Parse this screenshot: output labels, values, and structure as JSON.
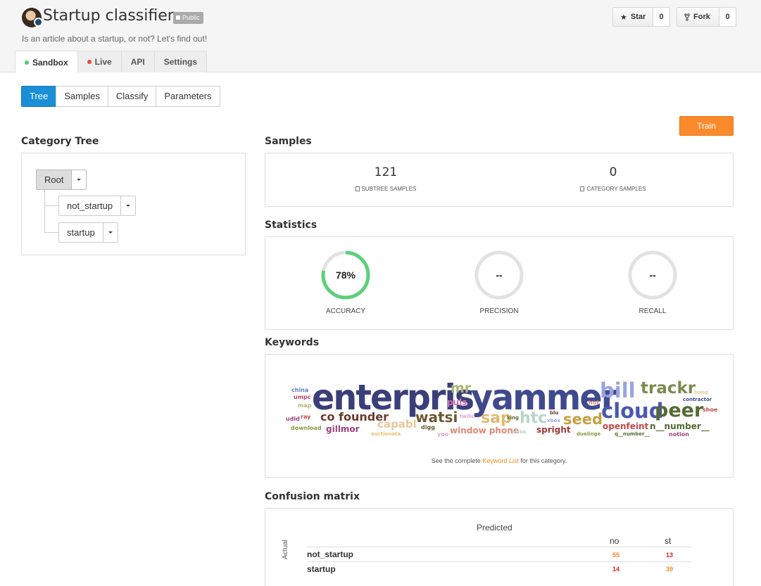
{
  "header": {
    "title": "Startup classifier",
    "visibility": "Public",
    "description": "Is an article about a startup, or not? Let's find out!",
    "star": {
      "label": "Star",
      "count": "0"
    },
    "fork": {
      "label": "Fork",
      "count": "0"
    },
    "tabs": [
      {
        "label": "Sandbox",
        "dot": "#4ccf6a"
      },
      {
        "label": "Live",
        "dot": "#e84a3c"
      },
      {
        "label": "API"
      },
      {
        "label": "Settings"
      }
    ]
  },
  "subnav": [
    "Tree",
    "Samples",
    "Classify",
    "Parameters"
  ],
  "train_label": "Train",
  "category_tree": {
    "title": "Category Tree",
    "root": "Root",
    "children": [
      "not_startup",
      "startup"
    ]
  },
  "samples": {
    "title": "Samples",
    "subtree_count": "121",
    "subtree_label": "SUBTREE SAMPLES",
    "category_count": "0",
    "category_label": "CATEGORY SAMPLES"
  },
  "statistics": {
    "title": "Statistics",
    "accuracy": {
      "value": "78%",
      "fraction": 0.78,
      "label": "ACCURACY"
    },
    "precision": {
      "value": "--",
      "label": "PRECISION"
    },
    "recall": {
      "value": "--",
      "label": "RECALL"
    },
    "gauge_color": "#5cd07a",
    "track_color": "#e2e2e2"
  },
  "keywords": {
    "title": "Keywords",
    "words": [
      {
        "text": "enterpris",
        "color": "#3a3f7a"
      },
      {
        "text": "yammer",
        "color": "#3f4a8e"
      },
      {
        "text": "bill",
        "color": "#9aa3e0"
      },
      {
        "text": "trackr",
        "color": "#7a8a4e"
      },
      {
        "text": "cloud",
        "color": "#4a58b0"
      },
      {
        "text": "peer",
        "color": "#556a34"
      },
      {
        "text": "mr",
        "color": "#a8b870"
      },
      {
        "text": "co founder",
        "color": "#6a3a2a"
      },
      {
        "text": "watsi",
        "color": "#6b5a30"
      },
      {
        "text": "sap",
        "color": "#e0b870"
      },
      {
        "text": "htc",
        "color": "#b8d4c8"
      },
      {
        "text": "seed",
        "color": "#c8a040"
      },
      {
        "text": "capabl",
        "color": "#e8c898"
      },
      {
        "text": "puls",
        "color": "#d070b0"
      },
      {
        "text": "gillmor",
        "color": "#9a4080"
      },
      {
        "text": "window phone",
        "color": "#e08878"
      },
      {
        "text": "spright",
        "color": "#a03838"
      },
      {
        "text": "openfeint",
        "color": "#c04848"
      },
      {
        "text": "n__number__",
        "color": "#556a34"
      },
      {
        "text": "china",
        "color": "#6a78c0"
      },
      {
        "text": "umpc",
        "color": "#c04060"
      },
      {
        "text": "map",
        "color": "#b8b078"
      },
      {
        "text": "ray",
        "color": "#c04848"
      },
      {
        "text": "udid",
        "color": "#9a4080"
      },
      {
        "text": "download",
        "color": "#8a9a40"
      },
      {
        "text": "twilio",
        "color": "#e8a0c8"
      },
      {
        "text": "king",
        "color": "#556a34"
      },
      {
        "text": "digg",
        "color": "#6b5a30"
      },
      {
        "text": "yoo",
        "color": "#e8a0c8"
      },
      {
        "text": "auctionata",
        "color": "#e8c070"
      },
      {
        "text": "ariba",
        "color": "#b8d4c8"
      },
      {
        "text": "blu",
        "color": "#6a3a2a"
      },
      {
        "text": "xbox",
        "color": "#9aa3e0"
      },
      {
        "text": "hot",
        "color": "#e08878"
      },
      {
        "text": "duelinge",
        "color": "#8a9a40"
      },
      {
        "text": "q__number__",
        "color": "#556a34"
      },
      {
        "text": "bond",
        "color": "#e8c898"
      },
      {
        "text": "contractor",
        "color": "#3f4a8e"
      },
      {
        "text": "shoe",
        "color": "#c04848"
      },
      {
        "text": "notion",
        "color": "#9a4080"
      }
    ],
    "note_prefix": "See the complete",
    "note_link": "Keyword List",
    "note_suffix": "for this category."
  },
  "confusion": {
    "title": "Confusion matrix",
    "predicted_label": "Predicted",
    "actual_label": "Actual",
    "columns": [
      "no",
      "st"
    ],
    "rows": [
      {
        "label": "not_startup",
        "cells": [
          "55",
          "13"
        ]
      },
      {
        "label": "startup",
        "cells": [
          "14",
          "39"
        ]
      }
    ],
    "correct_color": "#f08a24",
    "wrong_color": "#e02020"
  }
}
